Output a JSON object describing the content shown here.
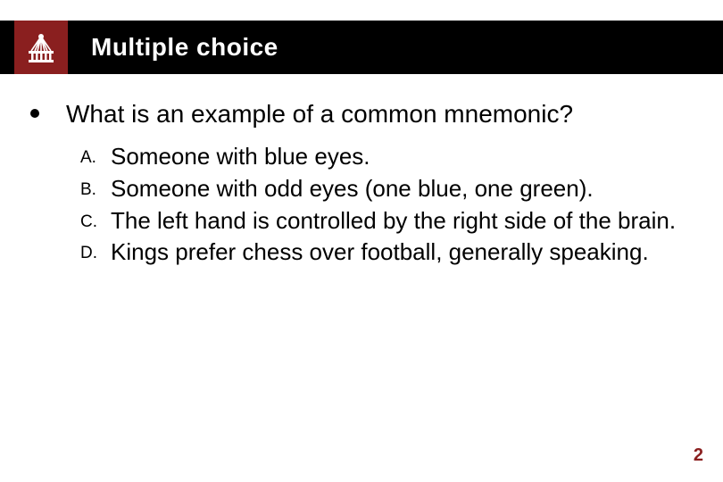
{
  "header": {
    "title": "Multiple choice"
  },
  "question": "What is an example of a common mnemonic?",
  "options": [
    {
      "letter": "A.",
      "text": "Someone with blue eyes."
    },
    {
      "letter": "B.",
      "text": "Someone with odd eyes (one blue, one green)."
    },
    {
      "letter": "C.",
      "text": "The left hand is controlled by the right side of the brain."
    },
    {
      "letter": "D.",
      "text": "Kings prefer chess over football, generally speaking."
    }
  ],
  "page_number": "2",
  "colors": {
    "accent": "#8a1f1f",
    "header_bg": "#000000"
  }
}
